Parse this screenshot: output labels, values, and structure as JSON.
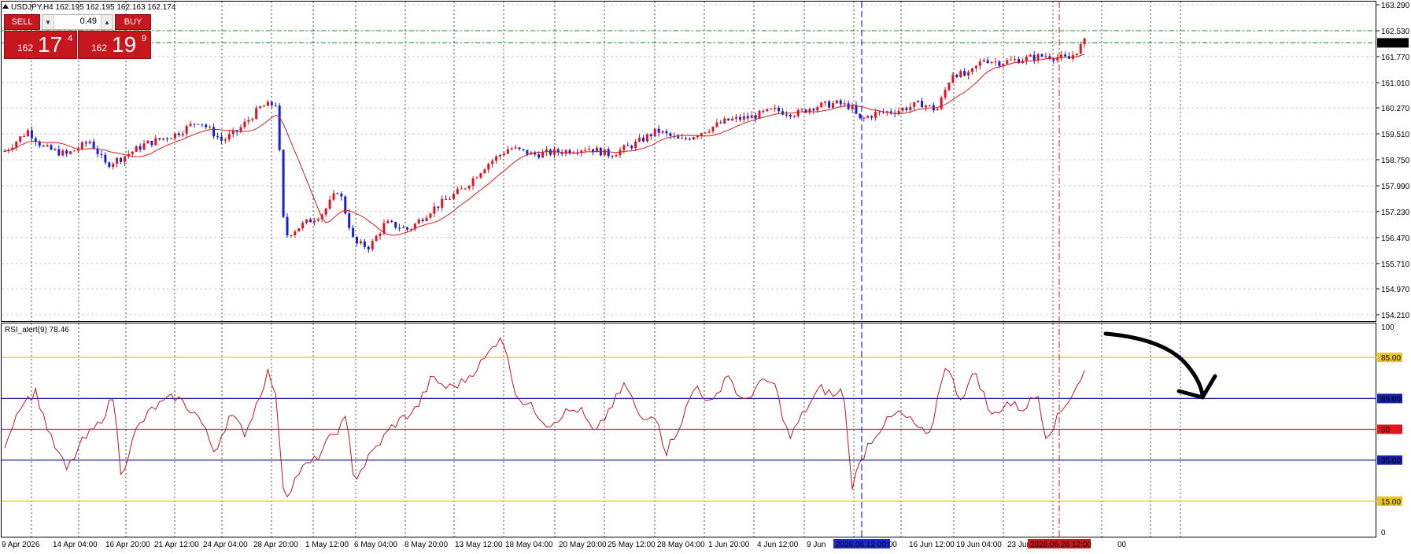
{
  "header": {
    "title": "USDJPY,H4  162.195 162.195 162.163 162.174"
  },
  "trade_panel": {
    "sell_label": "SELL",
    "buy_label": "BUY",
    "lot": "0.49",
    "sell_price": {
      "prefix": "162",
      "big": "17",
      "sup": "4"
    },
    "buy_price": {
      "prefix": "162",
      "big": "19",
      "sup": "9"
    }
  },
  "price_panel": {
    "ticks": [
      "163.290",
      "162.530",
      "161.770",
      "161.010",
      "160.270",
      "159.510",
      "158.750",
      "157.990",
      "157.230",
      "156.470",
      "155.710",
      "154.970",
      "154.210"
    ],
    "current_price_label": "162.174",
    "colors": {
      "bull": "#e0141e",
      "bear": "#1720d6",
      "ma": "#d11f1f",
      "green_line": "#168d16",
      "grid": "#a8a8a8"
    }
  },
  "rsi_panel": {
    "title": "RSI_alert(9) 78.46",
    "ticks": [
      "100",
      "85.00",
      "65.00",
      "50",
      "35.00",
      "15.00",
      "0"
    ],
    "colors": {
      "line": "#c0171f",
      "level_85_15": "#e8c51f",
      "level_65_35": "#1520a6",
      "level_50": "#e0141e"
    }
  },
  "time_axis": {
    "labels": [
      "9 Apr 2026",
      "14 Apr 04:00",
      "16 Apr 20:00",
      "21 Apr 12:00",
      "24 Apr 04:00",
      "28 Apr 20:00",
      "1 May 12:00",
      "6 May 04:00",
      "8 May 20:00",
      "13 May 12:00",
      "18 May 04:00",
      "20 May 20:00",
      "25 May 12:00",
      "28 May 04:00",
      "1 Jun 20:00",
      "4 Jun 12:00",
      "9 Jun",
      "16 Jun 12:00",
      "19 Jun 04:00",
      "23 Jun",
      "00"
    ],
    "highlight_blue": "2026.06.12 00:00",
    "highlight_red": "2026.06.26 12:00"
  },
  "chart_data": {
    "type": "candlestick",
    "symbol": "USDJPY",
    "timeframe": "H4",
    "ylim": [
      154.21,
      163.29
    ],
    "price_path": [
      {
        "x": 0,
        "y": 159.0
      },
      {
        "x": 3,
        "y": 159.6
      },
      {
        "x": 5,
        "y": 159.1
      },
      {
        "x": 8,
        "y": 158.9
      },
      {
        "x": 11,
        "y": 159.3
      },
      {
        "x": 13,
        "y": 158.6
      },
      {
        "x": 15,
        "y": 158.8
      },
      {
        "x": 18,
        "y": 159.2
      },
      {
        "x": 22,
        "y": 159.5
      },
      {
        "x": 25,
        "y": 159.9
      },
      {
        "x": 28,
        "y": 159.3
      },
      {
        "x": 30,
        "y": 159.6
      },
      {
        "x": 33,
        "y": 160.3
      },
      {
        "x": 35,
        "y": 160.4
      },
      {
        "x": 36,
        "y": 156.5
      },
      {
        "x": 38,
        "y": 156.8
      },
      {
        "x": 41,
        "y": 157.2
      },
      {
        "x": 43,
        "y": 157.9
      },
      {
        "x": 45,
        "y": 156.3
      },
      {
        "x": 47,
        "y": 156.2
      },
      {
        "x": 49,
        "y": 156.9
      },
      {
        "x": 52,
        "y": 156.7
      },
      {
        "x": 55,
        "y": 157.3
      },
      {
        "x": 59,
        "y": 157.9
      },
      {
        "x": 62,
        "y": 158.6
      },
      {
        "x": 65,
        "y": 159.1
      },
      {
        "x": 68,
        "y": 158.9
      },
      {
        "x": 72,
        "y": 159.0
      },
      {
        "x": 75,
        "y": 159.1
      },
      {
        "x": 78,
        "y": 158.9
      },
      {
        "x": 81,
        "y": 159.2
      },
      {
        "x": 84,
        "y": 159.6
      },
      {
        "x": 87,
        "y": 159.3
      },
      {
        "x": 90,
        "y": 159.6
      },
      {
        "x": 93,
        "y": 159.9
      },
      {
        "x": 96,
        "y": 160.0
      },
      {
        "x": 99,
        "y": 160.2
      },
      {
        "x": 102,
        "y": 160.1
      },
      {
        "x": 104,
        "y": 160.3
      },
      {
        "x": 107,
        "y": 160.4
      },
      {
        "x": 109,
        "y": 160.3
      },
      {
        "x": 110,
        "y": 159.9
      },
      {
        "x": 112,
        "y": 160.1
      },
      {
        "x": 115,
        "y": 160.2
      },
      {
        "x": 118,
        "y": 160.4
      },
      {
        "x": 120,
        "y": 160.2
      },
      {
        "x": 122,
        "y": 161.3
      },
      {
        "x": 124,
        "y": 161.2
      },
      {
        "x": 126,
        "y": 161.7
      },
      {
        "x": 128,
        "y": 161.6
      },
      {
        "x": 131,
        "y": 161.7
      },
      {
        "x": 134,
        "y": 161.8
      },
      {
        "x": 137,
        "y": 161.7
      },
      {
        "x": 139,
        "y": 162.2
      }
    ],
    "rsi": {
      "name": "RSI_alert(9)",
      "last": 78.46,
      "levels": [
        85,
        65,
        50,
        35,
        15
      ],
      "ylim": [
        0,
        100
      ],
      "path": [
        {
          "x": 0,
          "y": 43
        },
        {
          "x": 2,
          "y": 62
        },
        {
          "x": 4,
          "y": 68
        },
        {
          "x": 6,
          "y": 45
        },
        {
          "x": 8,
          "y": 30
        },
        {
          "x": 10,
          "y": 44
        },
        {
          "x": 12,
          "y": 52
        },
        {
          "x": 14,
          "y": 66
        },
        {
          "x": 15,
          "y": 28
        },
        {
          "x": 17,
          "y": 50
        },
        {
          "x": 19,
          "y": 60
        },
        {
          "x": 22,
          "y": 66
        },
        {
          "x": 25,
          "y": 56
        },
        {
          "x": 27,
          "y": 39
        },
        {
          "x": 29,
          "y": 57
        },
        {
          "x": 31,
          "y": 48
        },
        {
          "x": 34,
          "y": 79
        },
        {
          "x": 35,
          "y": 63
        },
        {
          "x": 36,
          "y": 16
        },
        {
          "x": 38,
          "y": 30
        },
        {
          "x": 40,
          "y": 35
        },
        {
          "x": 42,
          "y": 46
        },
        {
          "x": 44,
          "y": 55
        },
        {
          "x": 45,
          "y": 25
        },
        {
          "x": 47,
          "y": 37
        },
        {
          "x": 50,
          "y": 52
        },
        {
          "x": 53,
          "y": 60
        },
        {
          "x": 55,
          "y": 75
        },
        {
          "x": 57,
          "y": 70
        },
        {
          "x": 59,
          "y": 73
        },
        {
          "x": 62,
          "y": 85
        },
        {
          "x": 64,
          "y": 97
        },
        {
          "x": 65,
          "y": 79
        },
        {
          "x": 66,
          "y": 66
        },
        {
          "x": 68,
          "y": 60
        },
        {
          "x": 70,
          "y": 52
        },
        {
          "x": 72,
          "y": 58
        },
        {
          "x": 74,
          "y": 60
        },
        {
          "x": 76,
          "y": 47
        },
        {
          "x": 78,
          "y": 61
        },
        {
          "x": 80,
          "y": 72
        },
        {
          "x": 82,
          "y": 53
        },
        {
          "x": 84,
          "y": 58
        },
        {
          "x": 85,
          "y": 38
        },
        {
          "x": 87,
          "y": 53
        },
        {
          "x": 89,
          "y": 72
        },
        {
          "x": 91,
          "y": 61
        },
        {
          "x": 93,
          "y": 78
        },
        {
          "x": 95,
          "y": 62
        },
        {
          "x": 97,
          "y": 72
        },
        {
          "x": 99,
          "y": 73
        },
        {
          "x": 101,
          "y": 45
        },
        {
          "x": 103,
          "y": 59
        },
        {
          "x": 105,
          "y": 70
        },
        {
          "x": 107,
          "y": 66
        },
        {
          "x": 108,
          "y": 70
        },
        {
          "x": 109,
          "y": 22
        },
        {
          "x": 111,
          "y": 42
        },
        {
          "x": 113,
          "y": 52
        },
        {
          "x": 115,
          "y": 58
        },
        {
          "x": 117,
          "y": 53
        },
        {
          "x": 119,
          "y": 45
        },
        {
          "x": 121,
          "y": 82
        },
        {
          "x": 123,
          "y": 65
        },
        {
          "x": 125,
          "y": 78
        },
        {
          "x": 127,
          "y": 56
        },
        {
          "x": 129,
          "y": 63
        },
        {
          "x": 131,
          "y": 60
        },
        {
          "x": 133,
          "y": 67
        },
        {
          "x": 134,
          "y": 47
        },
        {
          "x": 135,
          "y": 52
        },
        {
          "x": 137,
          "y": 65
        },
        {
          "x": 139,
          "y": 78
        }
      ]
    },
    "ylabel": "",
    "xlabel": ""
  }
}
